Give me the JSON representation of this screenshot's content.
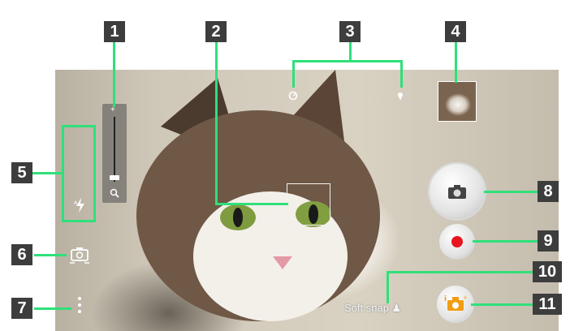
{
  "callouts": [
    "1",
    "2",
    "3",
    "4",
    "5",
    "6",
    "7",
    "8",
    "9",
    "10",
    "11"
  ],
  "zoom": {
    "plus_label": "+",
    "level": 0.1
  },
  "mode_label": "Soft snap ♟",
  "colors": {
    "callout_green": "#2fe07a",
    "badge_bg": "#3d3d3d",
    "record_red": "#e8141e"
  },
  "icons": [
    "zoom-icon",
    "flash-auto-icon",
    "camera-switch-icon",
    "menu-icon",
    "self-timer-icon",
    "location-icon",
    "camera-icon",
    "record-icon",
    "mode-icon"
  ]
}
